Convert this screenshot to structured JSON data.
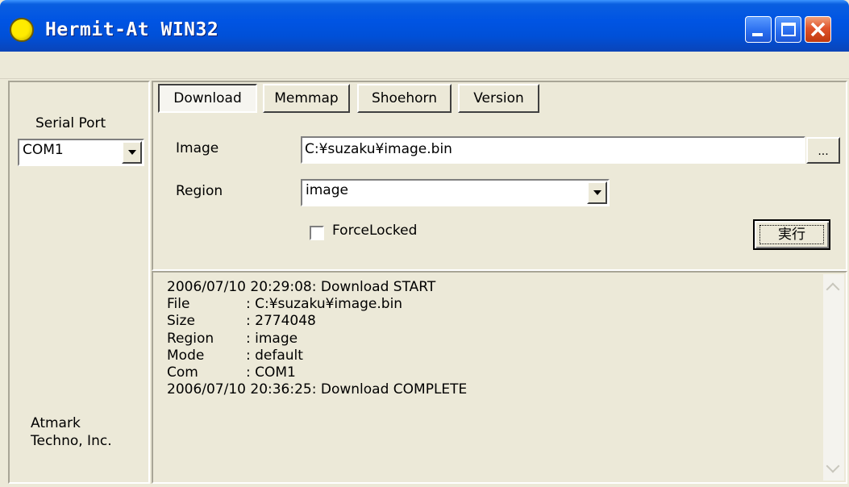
{
  "window": {
    "title": "Hermit-At WIN32"
  },
  "left_panel": {
    "serial_port_label": "Serial Port",
    "serial_port_value": "COM1",
    "company_line1": "Atmark",
    "company_line2": "Techno, Inc."
  },
  "tabs": [
    {
      "label": "Download",
      "active": true
    },
    {
      "label": "Memmap",
      "active": false
    },
    {
      "label": "Shoehorn",
      "active": false
    },
    {
      "label": "Version",
      "active": false
    }
  ],
  "download_form": {
    "image_label": "Image",
    "image_value": "C:¥suzaku¥image.bin",
    "browse_label": "...",
    "region_label": "Region",
    "region_value": "image",
    "force_locked_label": "ForceLocked",
    "force_locked_checked": false,
    "run_button_label": "実行"
  },
  "log": {
    "start_line": "2006/07/10 20:29:08: Download START",
    "entries": [
      {
        "key": "File",
        "value": ": C:¥suzaku¥image.bin"
      },
      {
        "key": "Size",
        "value": ": 2774048"
      },
      {
        "key": "Region",
        "value": ": image"
      },
      {
        "key": "Mode",
        "value": ": default"
      },
      {
        "key": "Com",
        "value": ": COM1"
      }
    ],
    "end_line": "2006/07/10 20:36:25: Download COMPLETE"
  },
  "colors": {
    "titlebar": "#0054e3",
    "face": "#ece9d8",
    "close_button": "#e0542c"
  }
}
